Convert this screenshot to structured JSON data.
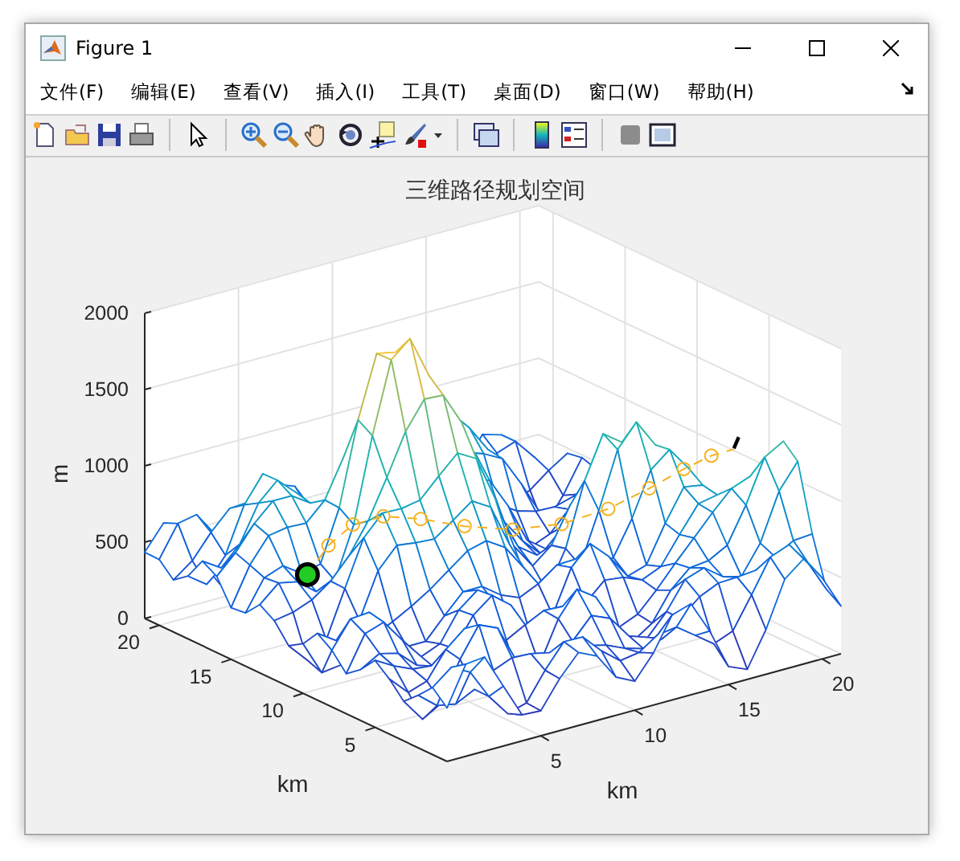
{
  "window": {
    "title": "Figure 1"
  },
  "menu": [
    "文件(F)",
    "编辑(E)",
    "查看(V)",
    "插入(I)",
    "工具(T)",
    "桌面(D)",
    "窗口(W)",
    "帮助(H)"
  ],
  "plot": {
    "title": "三维路径规划空间",
    "zlabel": "m",
    "xlabel": "km",
    "ylabel": "km",
    "zticks": [
      "2000",
      "1500",
      "1000",
      "500",
      "0"
    ],
    "xticks": [
      "5",
      "10",
      "15",
      "20"
    ],
    "yticks": [
      "5",
      "10",
      "15",
      "20"
    ]
  }
}
